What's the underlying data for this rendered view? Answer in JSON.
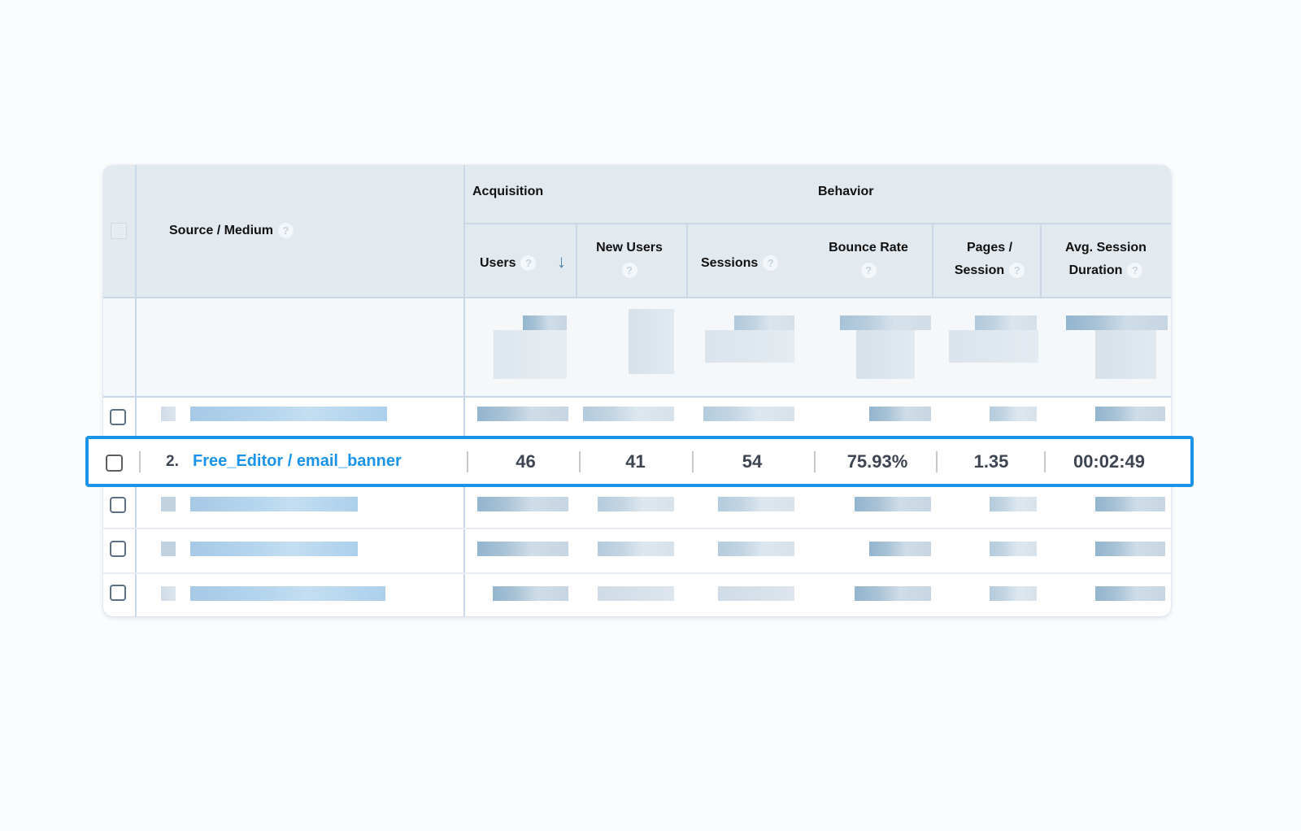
{
  "table": {
    "header": {
      "dimension_label": "Source / Medium",
      "groups": [
        {
          "label": "Acquisition"
        },
        {
          "label": "Behavior"
        }
      ],
      "columns": [
        {
          "label_line1": "Users",
          "label_line2": "",
          "sorted": "descending"
        },
        {
          "label_line1": "New Users",
          "label_line2": ""
        },
        {
          "label_line1": "Sessions",
          "label_line2": ""
        },
        {
          "label_line1": "Bounce Rate",
          "label_line2": ""
        },
        {
          "label_line1": "Pages /",
          "label_line2": "Session"
        },
        {
          "label_line1": "Avg. Session",
          "label_line2": "Duration"
        }
      ],
      "help_icon": "?",
      "sort_icon": "↓"
    },
    "highlighted_row": {
      "rank": "2.",
      "source_medium": "Free_Editor / email_banner",
      "users": "46",
      "new_users": "41",
      "sessions": "54",
      "bounce_rate": "75.93%",
      "pages_per_session": "1.35",
      "avg_session_duration": "00:02:49"
    },
    "obscured_rows_count": 4
  },
  "colors": {
    "highlight_border": "#1a94e8",
    "link": "#1a94e8",
    "header_bg": "#e2e9ef",
    "sort_arrow": "#4a7da3"
  }
}
